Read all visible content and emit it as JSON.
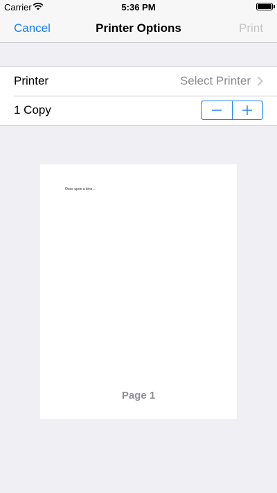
{
  "status_bar": {
    "carrier": "Carrier",
    "time": "5:36 PM",
    "wifi_icon": "wifi-icon",
    "battery_icon": "battery-icon",
    "battery_level": 1.0
  },
  "nav_bar": {
    "cancel_label": "Cancel",
    "title": "Printer Options",
    "print_label": "Print"
  },
  "options": {
    "printer": {
      "label": "Printer",
      "value": "Select Printer",
      "chevron_icon": "chevron-right-icon"
    },
    "copies": {
      "label": "1 Copy",
      "decrement_icon": "minus-icon",
      "increment_icon": "plus-icon"
    }
  },
  "preview": {
    "content_text": "Once upon a time...",
    "page_label": "Page 1"
  },
  "colors": {
    "accent": "#157efb",
    "disabled": "#c4c4c7",
    "secondary_text": "#8e8e93",
    "background": "#efeff4"
  }
}
